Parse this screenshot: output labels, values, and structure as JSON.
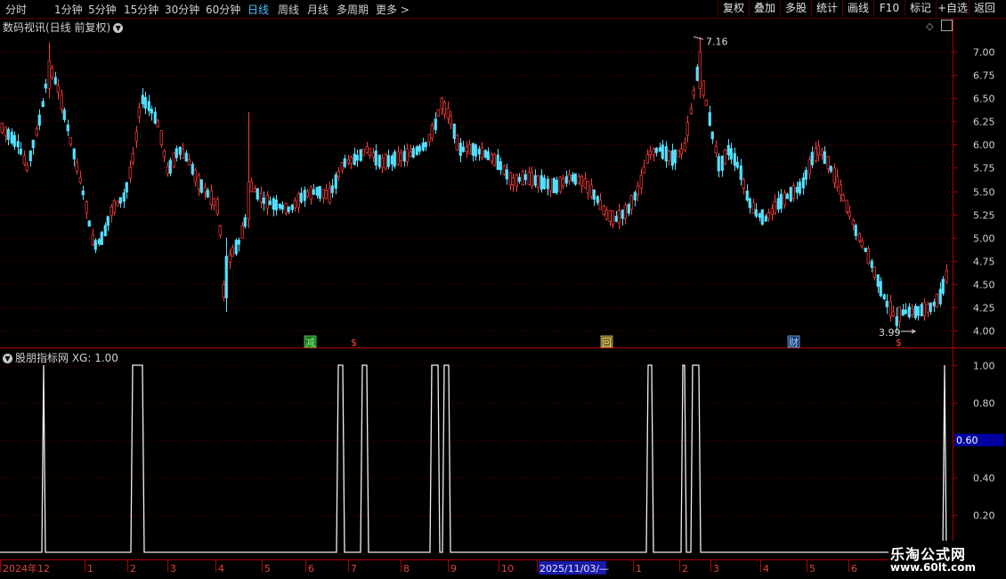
{
  "toolbar": {
    "periods": [
      "分时",
      "1分钟",
      "5分钟",
      "15分钟",
      "30分钟",
      "60分钟",
      "日线",
      "周线",
      "月线",
      "多周期",
      "更多 >"
    ],
    "active_period": "日线",
    "buttons": [
      "复权",
      "叠加",
      "多股",
      "统计",
      "画线",
      "F10",
      "标记",
      "+自选",
      "返回"
    ]
  },
  "main_chart": {
    "title": "数码视讯(日线 前复权)",
    "price_ticks": [
      "7.00",
      "6.75",
      "6.50",
      "6.25",
      "6.00",
      "5.75",
      "5.50",
      "5.25",
      "5.00",
      "4.75",
      "4.50",
      "4.25",
      "4.00"
    ],
    "high_label": "7.16",
    "low_label": "3.99",
    "event_markers": [
      "减",
      "$",
      "回",
      "财",
      "$"
    ]
  },
  "indicator": {
    "title": "股朋指标网 XG: 1.00",
    "ticks": [
      "1.00",
      "0.80",
      "0.60",
      "0.40",
      "0.20"
    ],
    "current_value": "0.60"
  },
  "time_axis": {
    "labels": [
      "2024年12",
      "1",
      "2",
      "3",
      "4",
      "5",
      "6",
      "7",
      "8",
      "9",
      "10",
      "2025/11/03/—",
      "1",
      "2",
      "3",
      "4",
      "5",
      "6"
    ]
  },
  "watermark": {
    "line1": "乐淘公式网",
    "line2": "www.60lt.com"
  },
  "colors": {
    "up": "#ff3c3c",
    "down": "#54e1ff",
    "grid": "#5a0000",
    "active": "#4ec3ff"
  }
}
